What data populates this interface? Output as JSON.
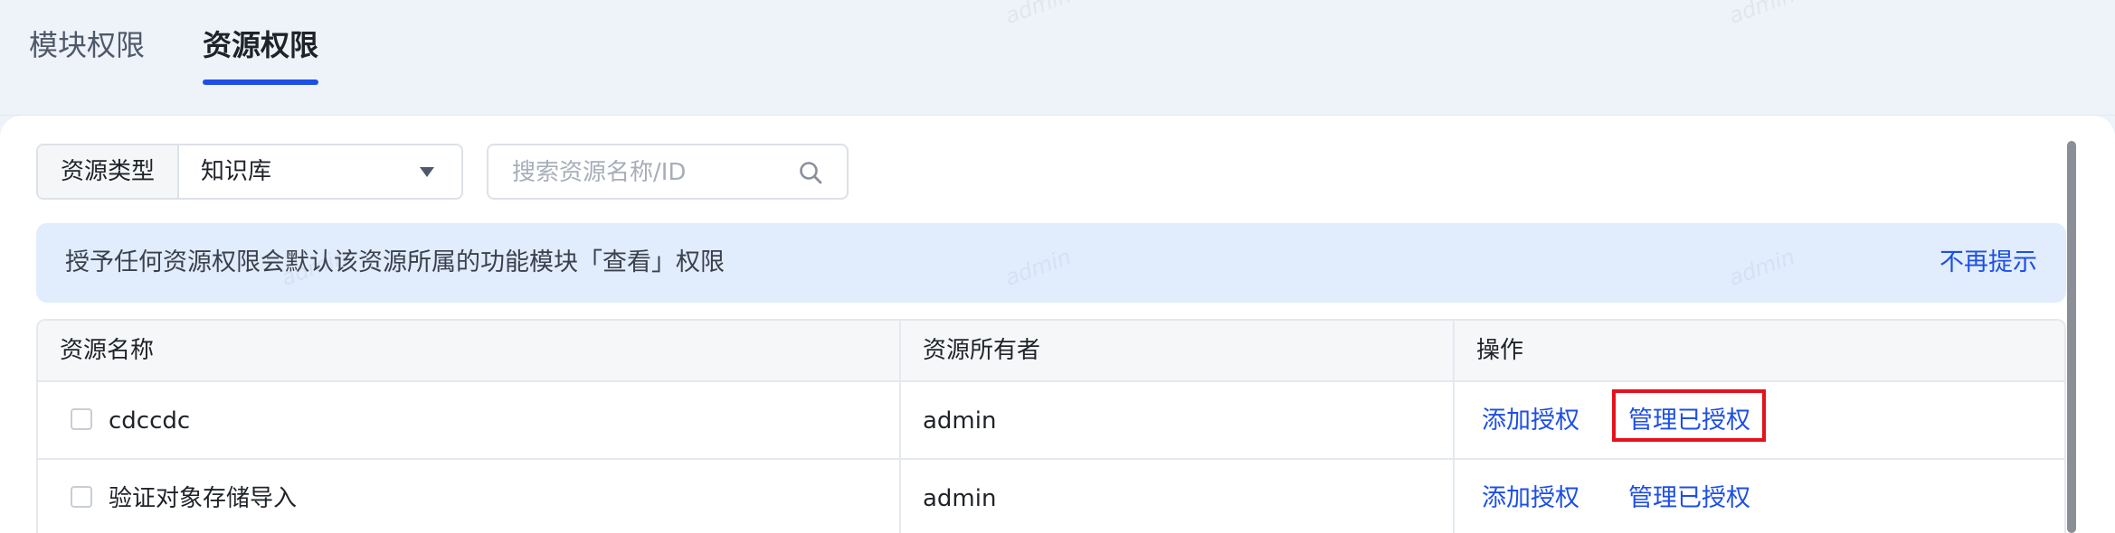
{
  "tabs": [
    {
      "label": "模块权限"
    },
    {
      "label": "资源权限"
    }
  ],
  "filter": {
    "type_label": "资源类型",
    "type_value": "知识库",
    "search_placeholder": "搜索资源名称/ID"
  },
  "notice": {
    "text": "授予任何资源权限会默认该资源所属的功能模块「查看」权限",
    "dismiss": "不再提示"
  },
  "table": {
    "headers": [
      "资源名称",
      "资源所有者",
      "操作"
    ],
    "rows": [
      {
        "name": "cdccdc",
        "owner": "admin",
        "action_add": "添加授权",
        "action_manage": "管理已授权"
      },
      {
        "name": "验证对象存储导入",
        "owner": "admin",
        "action_add": "添加授权",
        "action_manage": "管理已授权"
      }
    ]
  },
  "watermark": "admin",
  "colors": {
    "accent": "#1d4fe5",
    "highlight": "#e3121c",
    "notice_bg": "#e1ecfd"
  }
}
